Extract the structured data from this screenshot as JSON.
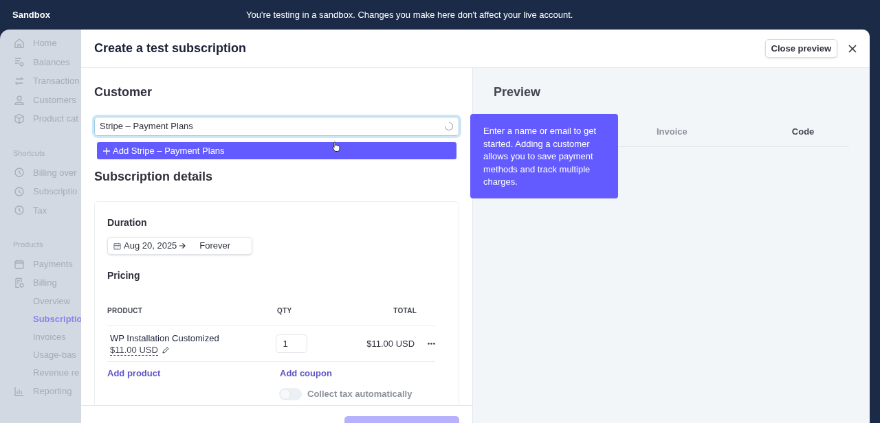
{
  "banner": {
    "label": "Sandbox",
    "message": "You're testing in a sandbox. Changes you make here don't affect your live account."
  },
  "sidebar": {
    "sections": [
      {
        "items": [
          {
            "label": "Home",
            "selected": false
          },
          {
            "label": "Balances",
            "selected": false
          },
          {
            "label": "Transaction",
            "selected": false
          },
          {
            "label": "Customers",
            "selected": false
          },
          {
            "label": "Product cat",
            "selected": false
          }
        ]
      },
      {
        "title": "Shortcuts",
        "items": [
          {
            "label": "Billing over",
            "selected": false
          },
          {
            "label": "Subscriptio",
            "selected": false
          },
          {
            "label": "Tax",
            "selected": false
          }
        ]
      },
      {
        "title": "Products",
        "items": [
          {
            "label": "Payments",
            "selected": false
          },
          {
            "label": "Billing",
            "selected": false,
            "children": [
              {
                "label": "Overview",
                "selected": false
              },
              {
                "label": "Subscriptio",
                "selected": true
              },
              {
                "label": "Invoices",
                "selected": false
              },
              {
                "label": "Usage-bas",
                "selected": false
              },
              {
                "label": "Revenue re",
                "selected": false
              }
            ]
          },
          {
            "label": "Reporting",
            "selected": false
          }
        ]
      }
    ]
  },
  "modal": {
    "title": "Create a test subscription",
    "close_preview": "Close preview",
    "customer": {
      "heading": "Customer",
      "value": "Stripe – Payment Plans",
      "loading": true,
      "suggestion": "Add Stripe – Payment Plans"
    },
    "details": {
      "heading": "Subscription details",
      "duration_label": "Duration",
      "start": "Aug 20, 2025",
      "end": "Forever",
      "pricing_label": "Pricing",
      "columns": [
        "PRODUCT",
        "QTY",
        "TOTAL"
      ],
      "rows": [
        {
          "product": "WP Installation Customized",
          "price": "$11.00 USD",
          "qty": "1",
          "total": "$11.00 USD"
        }
      ],
      "add_product": "Add product",
      "add_coupon": "Add coupon",
      "tax": {
        "label": "Collect tax automatically",
        "on": false
      }
    },
    "preview": {
      "heading": "Preview",
      "columns": [
        "Invoice",
        "Code"
      ],
      "tooltip": "Enter a name or email to get started. Adding a customer allows you to save payment methods and track multiple charges."
    }
  }
}
